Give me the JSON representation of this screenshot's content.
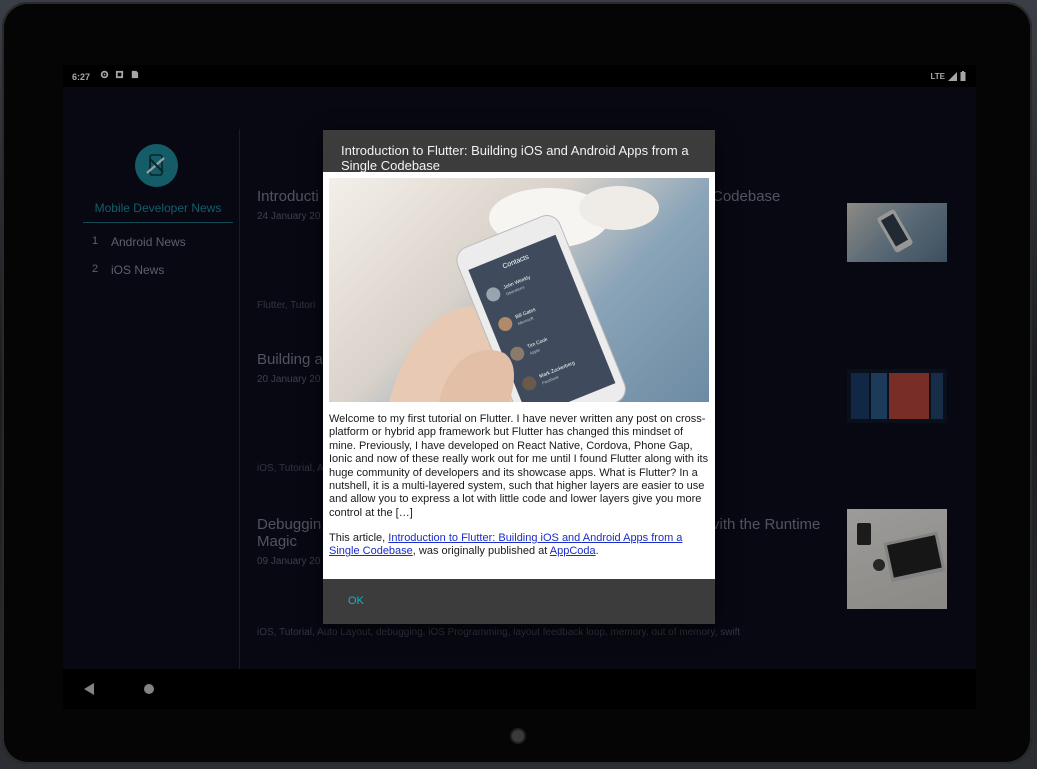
{
  "status_bar": {
    "time": "6:27",
    "network": "LTE",
    "icons": [
      "settings-icon",
      "notification-icon",
      "sd-card-icon",
      "signal-icon",
      "battery-icon"
    ]
  },
  "sidebar": {
    "title": "Mobile Developer News",
    "items": [
      {
        "num": "1",
        "label": "Android News"
      },
      {
        "num": "2",
        "label": "iOS News"
      }
    ]
  },
  "articles": [
    {
      "title_left": "Introducti",
      "title_right": "Codebase",
      "date": "24 January 20",
      "tags": "Flutter, Tutori"
    },
    {
      "title_left": "Building a",
      "date": "20 January 20",
      "tags": "iOS, Tutorial, A"
    },
    {
      "title_left": "Debuggin",
      "title_left2": "Magic",
      "title_right": "vith the Runtime",
      "date": "09 January 20",
      "tags": "iOS, Tutorial, Auto Layout, debugging, iOS Programming, layout feedback loop, memory, out of memory, swift"
    }
  ],
  "dialog": {
    "title": "Introduction to Flutter: Building iOS and Android Apps from a Single Codebase",
    "body": "Welcome to my first tutorial on Flutter. I have never written any post on cross-platform or hybrid app framework but Flutter has changed this mindset of mine.  Previously, I have developed on React Native, Cordova, Phone Gap, Ionic and now of these really work out for me until I found Flutter along with its huge community of developers and its showcase apps. What is Flutter? In a nutshell, it is a multi-layered system, such that higher layers are easier to use and allow you to express a lot with little code and lower layers give you more control at the […]",
    "footer_prefix": "This article, ",
    "footer_link": "Introduction to Flutter: Building iOS and Android Apps from a Single Codebase",
    "footer_middle": ", was originally published at ",
    "footer_source": "AppCoda",
    "footer_suffix": ".",
    "ok_label": "OK",
    "phone_header": "Contacts",
    "contacts": [
      {
        "name": "John Weekly",
        "sub": "Operations"
      },
      {
        "name": "Bill Gates",
        "sub": "Microsoft"
      },
      {
        "name": "Tim Cook",
        "sub": "Apple"
      },
      {
        "name": "Mark Zuckerberg",
        "sub": "Facebook"
      }
    ]
  },
  "colors": {
    "accent": "#1e8fa0",
    "background": "#0b0d1d",
    "dialog": "#3c3c3c",
    "link": "#1a2cc9"
  }
}
